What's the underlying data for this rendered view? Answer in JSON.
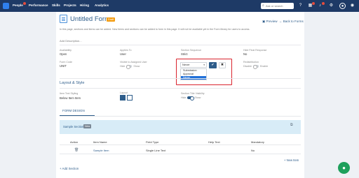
{
  "nav": {
    "brand": "People",
    "items": [
      "Performance",
      "Skills",
      "Projects",
      "Hiring",
      "Analytics"
    ],
    "search_placeholder": "Ask or search",
    "search_icon": "search-icon",
    "icons": [
      "help-icon",
      "calendar-icon",
      "bell-icon",
      "settings-icon",
      "user-avatar-icon"
    ]
  },
  "header": {
    "title": "Untitled Form",
    "badge": "Draft",
    "preview": "Preview",
    "back": "Back to Forms",
    "description": "In this page, sections and items can be added. New items and sections can be added to form in this page. It will not be available yet in the Form library for users to access."
  },
  "meta": {
    "add_description": "Add Description...",
    "availability": {
      "label": "Availability",
      "value": "Open"
    },
    "applies_to": {
      "label": "Applies To",
      "value": "User"
    },
    "section_sequence": {
      "label": "Section Sequence",
      "value": "Strict"
    },
    "hide_final_response": {
      "label": "Hide Final Response",
      "value": "No"
    },
    "form_code": {
      "label": "Form Code",
      "value": "UNIT"
    },
    "visible_assigned": {
      "label": "Visible to Assigned User",
      "off": "Hide",
      "on": "Show"
    },
    "redundant_sub": {
      "label": "Redundant Subs",
      "off": "Disable",
      "on": "Enable"
    },
    "redistribution": {
      "label": "Redistribution",
      "off": "Disable",
      "on": "Enable"
    }
  },
  "popup": {
    "selected": "Never",
    "options": [
      "Submission",
      "Approval",
      "Never"
    ],
    "confirm_icon": "check-icon",
    "cancel_icon": "close-icon"
  },
  "layout_style": {
    "heading": "Layout & Style",
    "item_text_styling": {
      "label": "Item Text Styling",
      "value": "Below Item Item"
    },
    "layout_label": "Layout",
    "section_title_visibility": {
      "label": "Section Title Visibility",
      "off": "Hide",
      "on": "Show"
    }
  },
  "tabs": {
    "form_design": "FORM DESIGN"
  },
  "section": {
    "name": "Sample Section",
    "badge": "New",
    "edit_icon": "external-edit-icon"
  },
  "table": {
    "headers": [
      "Action",
      "Item Name",
      "Field Type",
      "Help Text",
      "Mandatory"
    ],
    "rows": [
      {
        "action_icon": "trash-icon",
        "item_name": "Sample Item",
        "field_type": "Single Line Text",
        "help_text": "",
        "mandatory": "No"
      }
    ],
    "new_item": "+ New Item"
  },
  "add_section": "+ Add Section",
  "chat_icon": "chat-icon",
  "colors": {
    "nav_bg": "#1e3a66",
    "accent": "#2d5c8a",
    "highlight": "#d9232d",
    "section_bg": "#d8ecf7",
    "fab": "#1ea05c"
  }
}
